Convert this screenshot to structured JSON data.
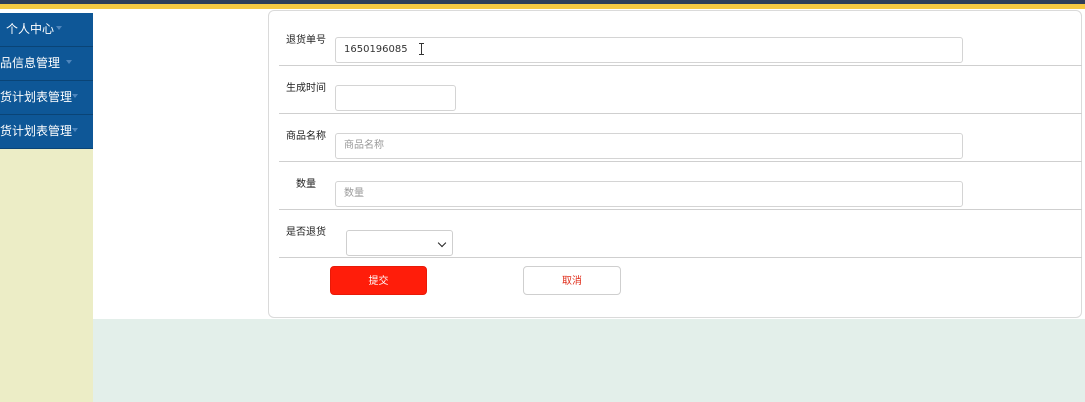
{
  "sidebar": {
    "items": [
      {
        "label": "个人中心"
      },
      {
        "label": "商品信息管理"
      },
      {
        "label": "进货计划表管理"
      },
      {
        "label": "退货计划表管理"
      }
    ]
  },
  "form": {
    "return_no": {
      "label": "退货单号",
      "value": "1650196085"
    },
    "created_time": {
      "label": "生成时间",
      "value": ""
    },
    "product_name": {
      "label": "商品名称",
      "placeholder": "商品名称"
    },
    "quantity": {
      "label": "数量",
      "placeholder": "数量"
    },
    "is_returned": {
      "label": "是否退货",
      "selected": ""
    }
  },
  "buttons": {
    "submit": "提交",
    "cancel": "取消"
  },
  "colors": {
    "sidebar_item": "#0e5797",
    "sidebar_bg": "#ecedc6",
    "top_dark": "#2e3d58",
    "top_gold": "#f5c842",
    "submit": "#ff1d0a",
    "content_bottom": "#e3efea"
  }
}
